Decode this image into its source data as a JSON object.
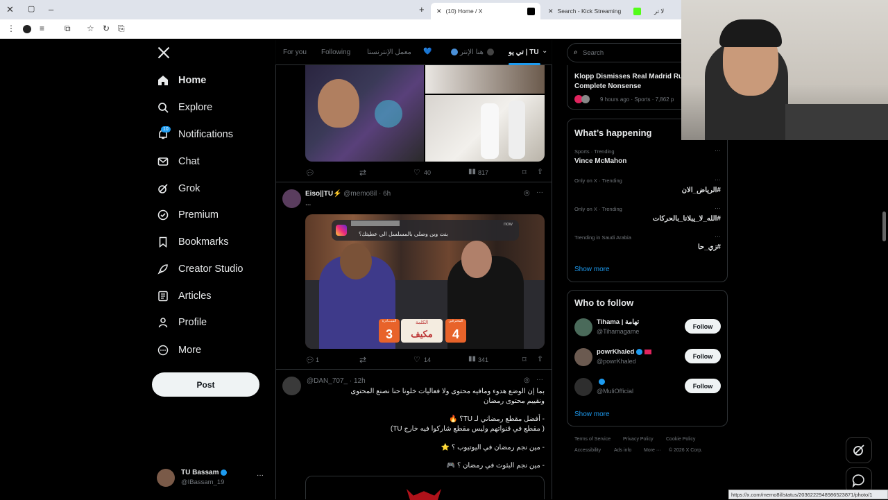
{
  "browser": {
    "tabs": [
      {
        "label": "(10) Home / X",
        "active": true
      },
      {
        "label": "Search - Kick Streaming",
        "active": false
      },
      {
        "label": "لا تر",
        "active": false
      }
    ],
    "new_tab_symbol": "+"
  },
  "nav": {
    "items": [
      {
        "label": "Home",
        "icon": "home-icon"
      },
      {
        "label": "Explore",
        "icon": "search-icon"
      },
      {
        "label": "Notifications",
        "icon": "bell-icon"
      },
      {
        "label": "Chat",
        "icon": "mail-icon"
      },
      {
        "label": "Grok",
        "icon": "grok-icon"
      },
      {
        "label": "Premium",
        "icon": "premium-icon"
      },
      {
        "label": "Bookmarks",
        "icon": "bookmark-icon"
      },
      {
        "label": "Creator Studio",
        "icon": "rocket-icon"
      },
      {
        "label": "Articles",
        "icon": "article-icon"
      },
      {
        "label": "Profile",
        "icon": "person-icon"
      },
      {
        "label": "More",
        "icon": "more-circle-icon"
      }
    ],
    "notifications_badge": "10",
    "post_label": "Post",
    "account": {
      "name": "TU Bassam",
      "handle": "@IBassam_19",
      "more": "···"
    }
  },
  "topnav": {
    "tabs": [
      "For you",
      "Following",
      "معمل الإنترنستا",
      "هنا الإنتر",
      "تي يو | TU"
    ]
  },
  "feed": {
    "tweet1_actions": {
      "reply": "",
      "retweet": "",
      "likes": "40",
      "views": "817"
    },
    "tweet2": {
      "author": "Eiso||TU⚡",
      "handle": "@memo8il",
      "time": "· 6h",
      "text": "...",
      "notif_text": "بنت وين وصلي بالمسلسل الي عطيتك؟",
      "notif_time": "now",
      "overlay_left_num": "3",
      "overlay_word": "مكيف",
      "overlay_right_num": "4",
      "overlay_label_left": "المبـــادرة",
      "overlay_label_mid": "الكلمة",
      "overlay_label_right": "المحترفين",
      "actions": {
        "reply": "1",
        "retweet": "",
        "likes": "14",
        "views": "341"
      }
    },
    "tweet3": {
      "handle": "@DAN_707_",
      "time": "· 12h",
      "line1": "بما إن الوضع هدوء ومافيه محتوى ولا فعاليات خلونا حنا نصنع المحتوى",
      "line2": "ونقييم محتوى رمضان",
      "line3": "- أفضل مقطع رمضاني لـ TU؟ 🔥",
      "line4": "( مقطع في قنواتهم وليس مقطع شاركوا فيه خارج TU)",
      "line5": "- مين نجم رمضان في اليوتيوب ؟ ⭐",
      "line6": "- مين نجم البثوث في رمضان ؟ 🎮"
    }
  },
  "right": {
    "search_placeholder": "Search",
    "news": {
      "title": "Klopp Dismisses Real Madrid Ru",
      "title2": "Complete Nonsense",
      "meta": "9 hours ago · Sports · 7,862 p"
    },
    "whats_happening": {
      "title": "What’s happening",
      "trends": [
        {
          "meta": "Sports · Trending",
          "name": "Vince McMahon"
        },
        {
          "meta": "Only on X · Trending",
          "name": "#الرياض_الان"
        },
        {
          "meta": "Only on X · Trending",
          "name": "#الله_لا_يبلانا_بالحركات"
        },
        {
          "meta": "Trending in Saudi Arabia",
          "name": "#زي_حا"
        }
      ],
      "show_more": "Show more"
    },
    "who_to_follow": {
      "title": "Who to follow",
      "accounts": [
        {
          "name": "Tihama | تهامة",
          "handle": "@Tihamagame",
          "button": "Follow"
        },
        {
          "name": "powrKhaled",
          "handle": "@powrKhaled",
          "button": "Follow"
        },
        {
          "name": "",
          "handle": "@MuliOfficial",
          "button": "Follow"
        }
      ],
      "show_more": "Show more"
    },
    "footer": [
      "Terms of Service",
      "Privacy Policy",
      "Cookie Policy",
      "Accessibility",
      "Ads info",
      "More ···",
      "© 2026 X Corp."
    ]
  },
  "status_url": "https://x.com/memo8il/status/2036222948986523871/photo/1",
  "colors": {
    "accent": "#1d9bf0",
    "bg": "#000000",
    "border": "#2f3336",
    "muted": "#71767b"
  }
}
